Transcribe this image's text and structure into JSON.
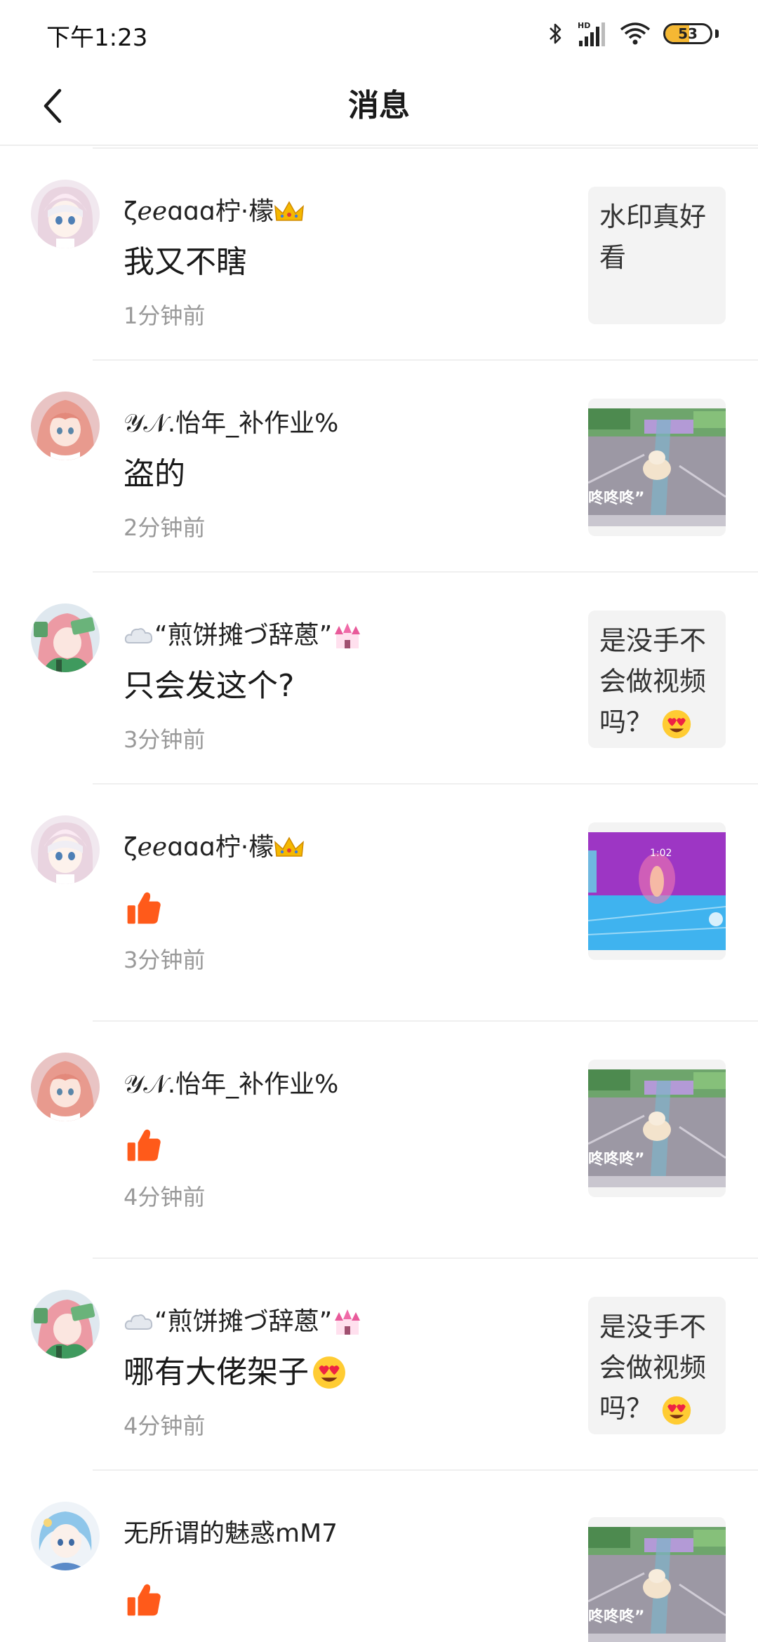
{
  "status_bar": {
    "time": "下午1:23",
    "battery": "53",
    "battery_level": 0.53,
    "network": "HD"
  },
  "nav": {
    "title": "消息"
  },
  "messages": [
    {
      "user": "ζℯℯɑɑɑ柠·檬",
      "text": "我又不瞎",
      "time": "1分钟前",
      "preview": {
        "kind": "text",
        "text": "水印真好看"
      }
    },
    {
      "user": "𝒴𝒩.怡年_补作业%",
      "text": "盗的",
      "time": "2分钟前",
      "preview": {
        "kind": "video",
        "caption": "咚咚咚”"
      }
    },
    {
      "user": "“煎饼摊づ辞蒽”",
      "text": "只会发这个?",
      "time": "3分钟前",
      "preview": {
        "kind": "text",
        "text": "是没手不会做视频吗？"
      }
    },
    {
      "user": "ζℯℯɑɑɑ柠·檬",
      "text": "",
      "time": "3分钟前",
      "preview": {
        "kind": "video",
        "caption": "1:02"
      }
    },
    {
      "user": "𝒴𝒩.怡年_补作业%",
      "text": "",
      "time": "4分钟前",
      "preview": {
        "kind": "video",
        "caption": "咚咚咚”"
      }
    },
    {
      "user": "“煎饼摊づ辞蒽”",
      "text": "哪有大佬架子",
      "time": "4分钟前",
      "preview": {
        "kind": "text",
        "text": "是没手不会做视频吗？"
      }
    },
    {
      "user": "无所谓的魅惑mM7",
      "text": "",
      "time": "",
      "preview": {
        "kind": "video",
        "caption": "咚咚咚”"
      }
    }
  ],
  "colors": {
    "like": "#ff5a1a",
    "accent": "#f5b833",
    "time_text": "#999999",
    "divider": "#efefef"
  },
  "icons": {
    "back": "chevron-left-icon",
    "like": "thumbs-up-icon",
    "crown": "crown-icon",
    "heart_eyes": "heart-eyes-emoji",
    "castle": "castle-icon",
    "cloud": "cloud-icon"
  }
}
